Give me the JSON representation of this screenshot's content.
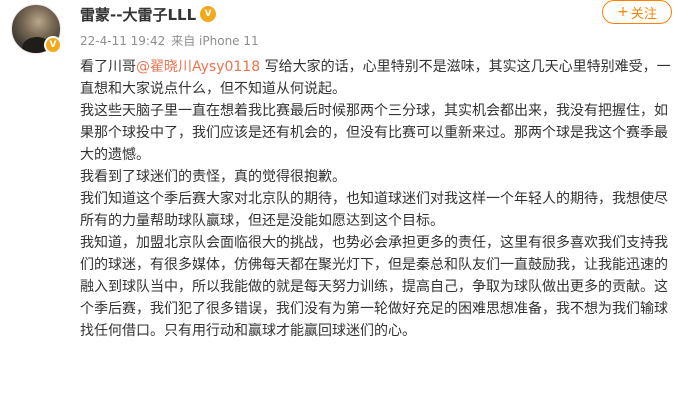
{
  "header": {
    "user_name": "雷蒙--大雷子LLL",
    "timestamp": "22-4-11 19:42",
    "source": "来自 iPhone 11",
    "follow_plus": "+",
    "follow_label": "关注"
  },
  "post": {
    "para1_prefix": "看了川哥",
    "mention": "@翟晓川Aysy0118",
    "para1_suffix": " 写给大家的话，心里特别不是滋味，其实这几天心里特别难受，一直想和大家说点什么，但不知道从何说起。",
    "para2": "我这些天脑子里一直在想着我比赛最后时候那两个三分球，其实机会都出来，我没有把握住，如果那个球投中了，我们应该是还有机会的，但没有比赛可以重新来过。那两个球是我这个赛季最大的遗憾。",
    "para3": "我看到了球迷们的责怪，真的觉得很抱歉。",
    "para4": "我们知道这个季后赛大家对北京队的期待，也知道球迷们对我这样一个年轻人的期待，我想使尽所有的力量帮助球队赢球，但还是没能如愿达到这个目标。",
    "para5": "我知道，加盟北京队会面临很大的挑战，也势必会承担更多的责任，这里有很多喜欢我们支持我们的球迷，有很多媒体，仿佛每天都在聚光灯下，但是秦总和队友们一直鼓励我，让我能迅速的融入到球队当中，所以我能做的就是每天努力训练，提高自己，争取为球队做出更多的贡献。这个季后赛，我们犯了很多错误，我们没有为第一轮做好充足的困难思想准备，我不想为我们输球找任何借口。只有用行动和赢球才能赢回球迷们的心。"
  },
  "colors": {
    "accent": "#ff8200",
    "mention": "#eb7350",
    "meta": "#8e8e8e",
    "text": "#333333"
  }
}
